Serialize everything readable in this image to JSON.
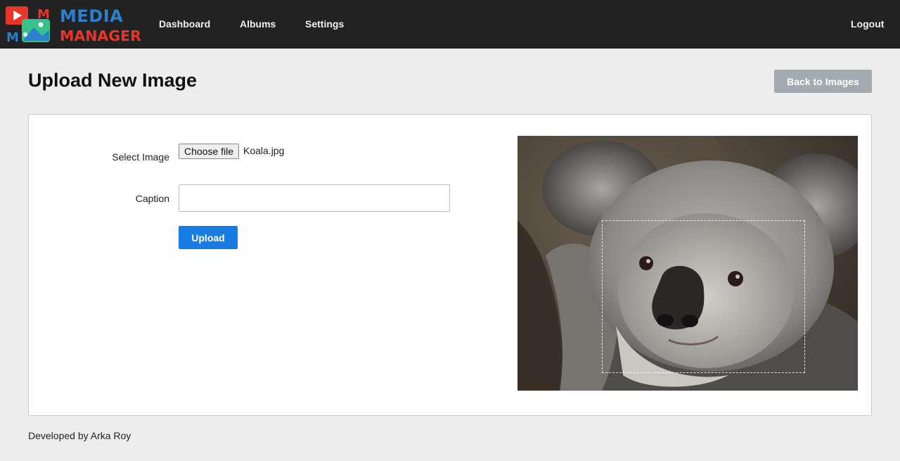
{
  "brand": {
    "logo_text_line1": "MEDIA",
    "logo_text_line2": "MANAGER",
    "logo_letter": "M",
    "colors": {
      "red": "#e8352a",
      "blue": "#2c7fcb",
      "green": "#36c28a"
    }
  },
  "nav": {
    "items": [
      {
        "label": "Dashboard"
      },
      {
        "label": "Albums"
      },
      {
        "label": "Settings"
      }
    ],
    "logout_label": "Logout"
  },
  "header": {
    "title": "Upload New Image",
    "back_label": "Back to Images"
  },
  "form": {
    "select_label": "Select Image",
    "choose_file_label": "Choose file",
    "file_name": "Koala.jpg",
    "caption_label": "Caption",
    "caption_value": "",
    "upload_label": "Upload"
  },
  "preview": {
    "subject": "koala photo with crop selection"
  },
  "footer": {
    "text": "Developed by Arka Roy"
  }
}
